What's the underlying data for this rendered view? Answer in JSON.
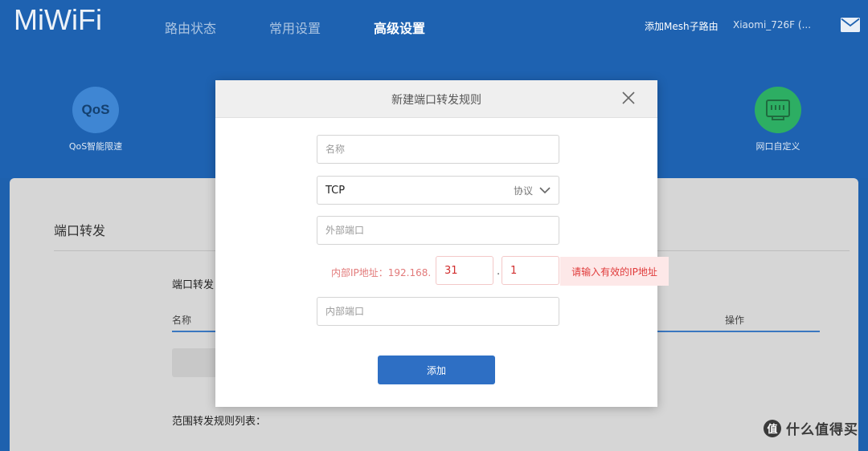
{
  "header": {
    "logo": "MiWiFi",
    "nav": [
      {
        "label": "路由状态"
      },
      {
        "label": "常用设置"
      },
      {
        "label": "高级设置"
      }
    ],
    "mesh_link": "添加Mesh子路由",
    "router_name": "Xiaomi_726F (...",
    "features": [
      {
        "label": "QoS智能限速",
        "icon_text": "QoS",
        "icon": "qos-icon",
        "color": "#3f86d3"
      },
      {
        "label": "网口自定义",
        "icon": "ethernet-port-icon",
        "color": "#2dae63"
      }
    ]
  },
  "panel": {
    "title": "端口转发",
    "section_title": "端口转发",
    "columns": {
      "name": "名称",
      "action": "操作"
    },
    "range_title": "范围转发规则列表："
  },
  "modal": {
    "title": "新建端口转发规则",
    "name_placeholder": "名称",
    "protocol_value": "TCP",
    "protocol_label": "协议",
    "external_port_placeholder": "外部端口",
    "ip_label": "内部IP地址：192.168.",
    "ip_octet3": "31",
    "ip_dot": ".",
    "ip_octet4": "1",
    "ip_error": "请输入有效的IP地址",
    "internal_port_placeholder": "内部端口",
    "add_label": "添加"
  },
  "watermark": {
    "badge": "值",
    "text": "什么值得买"
  },
  "colors": {
    "header_bg": "#1e62b1",
    "primary_button": "#2e6fc4",
    "error_text": "#e03a3a",
    "error_bg": "#fde8e8"
  }
}
